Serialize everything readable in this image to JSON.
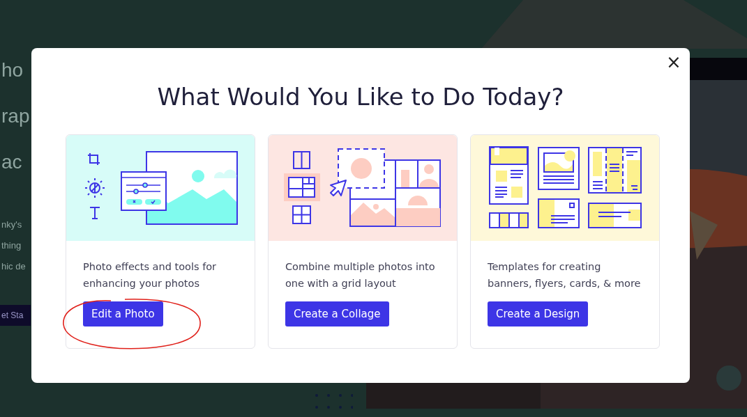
{
  "background_page": {
    "headline": [
      "ho",
      "rap",
      "ac"
    ],
    "paragraph": [
      "nky's",
      "thing",
      "hic de"
    ],
    "button": "et Sta"
  },
  "dialog": {
    "title": "What Would You Like to Do Today?",
    "close": "×",
    "cards": [
      {
        "kind": "edit",
        "description": "Photo effects and tools for enhancing your photos",
        "button": "Edit a Photo",
        "circled": true
      },
      {
        "kind": "collage",
        "description": "Combine multiple photos into one with a grid layout",
        "button": "Create a Collage",
        "circled": false
      },
      {
        "kind": "design",
        "description": "Templates for creating banners, flyers, cards, & more",
        "button": "Create a Design",
        "circled": false
      }
    ]
  }
}
